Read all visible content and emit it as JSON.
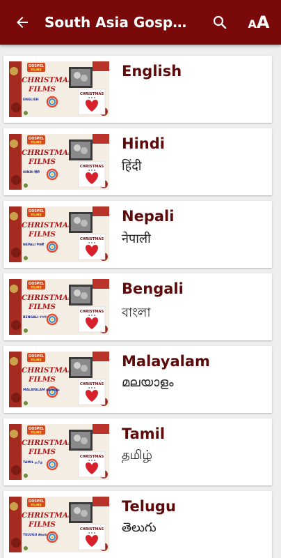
{
  "appbar": {
    "title": "South Asia Gospel Films",
    "back_icon": "arrow-left-icon",
    "search_icon": "search-icon",
    "font_icon": "font-size-icon",
    "font_small": "A",
    "font_big": "A",
    "color": "#7a0a0a"
  },
  "thumbnail": {
    "badge_top": "GOSPEL",
    "badge_bottom": "FILMS",
    "line1": "CHRISTMAS",
    "line2": "FILMS",
    "inset_title": "CHRISTMAS",
    "inset_sub": "★ ★ ★"
  },
  "languages": [
    {
      "name": "English",
      "native": "",
      "tag": "ENGLISH",
      "tag_native": ""
    },
    {
      "name": "Hindi",
      "native": "हिंदी",
      "tag": "HINDI",
      "tag_native": "हिंदी"
    },
    {
      "name": "Nepali",
      "native": "नेपाली",
      "tag": "NEPALI",
      "tag_native": "नेपाली"
    },
    {
      "name": "Bengali",
      "native": "বাংলা",
      "tag": "BENGALI",
      "tag_native": "বাংলা"
    },
    {
      "name": "Malayalam",
      "native": "മലയാളം",
      "tag": "MALAYALAM",
      "tag_native": "മലയാളം"
    },
    {
      "name": "Tamil",
      "native": "தமிழ்",
      "tag": "TAMIL",
      "tag_native": "தமிழ்"
    },
    {
      "name": "Telugu",
      "native": "తెలుగు",
      "tag": "TELUGU",
      "tag_native": "తెలుగు"
    }
  ]
}
